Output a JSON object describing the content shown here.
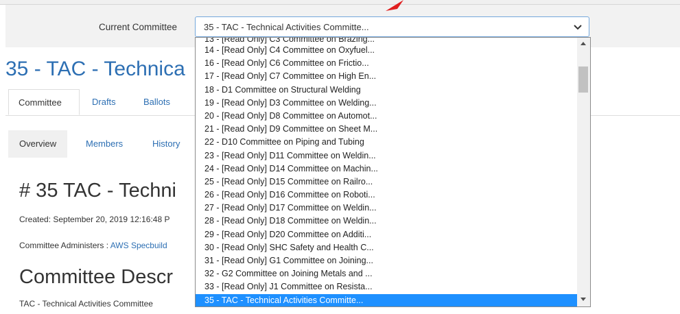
{
  "header": {
    "current_committee_label": "Current Committee",
    "select_value": "35 - TAC - Technical Activities Committe..."
  },
  "page": {
    "title": "35 - TAC - Technica",
    "tabs": [
      {
        "label": "Committee",
        "active": true
      },
      {
        "label": "Drafts",
        "active": false
      },
      {
        "label": "Ballots",
        "active": false
      }
    ],
    "subtabs": [
      {
        "label": "Overview",
        "active": true
      },
      {
        "label": "Members",
        "active": false
      },
      {
        "label": "History",
        "active": false
      }
    ],
    "heading": "# 35 TAC - Techni",
    "created": "Created: September 20, 2019 12:16:48 P",
    "administers_label": "Committee Administers : ",
    "administers_link": "AWS Specbuild",
    "description_heading": "Committee Descr",
    "description_text": "TAC - Technical Activities Committee"
  },
  "dropdown": {
    "partial_top": "13 - [Read Only] C3 Committee on Brazing...",
    "items": [
      "14 - [Read Only] C4 Committee on Oxyfuel...",
      "16 - [Read Only] C6 Committee on Frictio...",
      "17 - [Read Only] C7 Committee on High En...",
      "18 - D1 Committee on Structural Welding",
      "19 - [Read Only] D3 Committee on Welding...",
      "20 - [Read Only] D8 Committee on Automot...",
      "21 - [Read Only] D9 Committee on Sheet M...",
      "22 - D10 Committee on Piping and Tubing",
      "23 - [Read Only] D11 Committee on Weldin...",
      "24 - [Read Only] D14 Committee on Machin...",
      "25 - [Read Only] D15 Committee on Railro...",
      "26 - [Read Only] D16 Committee on Roboti...",
      "27 - [Read Only] D17 Committee on Weldin...",
      "28 - [Read Only] D18 Committee on Weldin...",
      "29 - [Read Only] D20 Committee on Additi...",
      "30 - [Read Only] SHC Safety and Health C...",
      "31 - [Read Only] G1 Committee on Joining...",
      "32 - G2 Committee on Joining Metals and ...",
      "33 - [Read Only] J1 Committee on Resista...",
      "35 - TAC - Technical Activities Committe..."
    ],
    "selected_index": 19
  },
  "colors": {
    "link": "#2d6fb3",
    "selected_bg": "#1e90ff",
    "annotation_arrow": "#e02020"
  },
  "icons": {
    "chevron": "chevron-down-icon",
    "arrow": "annotation-arrow-icon"
  }
}
